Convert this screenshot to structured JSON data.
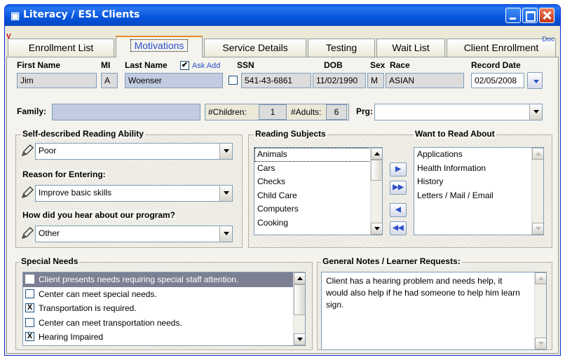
{
  "window": {
    "title": "Literacy / ESL Clients",
    "v_tag": "V",
    "doc_tag": "Doc"
  },
  "tabs": [
    {
      "label": "Enrollment List",
      "active": false
    },
    {
      "label": "Motivations",
      "active": true
    },
    {
      "label": "Service Details",
      "active": false
    },
    {
      "label": "Testing",
      "active": false
    },
    {
      "label": "Wait List",
      "active": false
    },
    {
      "label": "Client Enrollment",
      "active": false
    }
  ],
  "client": {
    "labels": {
      "first_name": "First Name",
      "mi": "MI",
      "last_name": "Last Name",
      "ask_add": "Ask Add",
      "ssn": "SSN",
      "dob": "DOB",
      "sex": "Sex",
      "race": "Race",
      "record_date": "Record Date",
      "family": "Family:",
      "children": "#Children:",
      "adults": "#Adults:",
      "prg": "Prg:"
    },
    "first_name": "Jim",
    "mi": "A",
    "last_name": "Woenser",
    "ask_add_checked": true,
    "ssn": "541-43-6861",
    "dob": "11/02/1990",
    "sex": "M",
    "race": "ASIAN",
    "record_date": "02/05/2008",
    "family": "",
    "children": "1",
    "adults": "6",
    "prg": ""
  },
  "reading": {
    "ability_label": "Self-described Reading Ability",
    "ability": "Poor",
    "reason_label": "Reason for Entering:",
    "reason": "Improve basic skills",
    "heard_label": "How did you hear about our program?",
    "heard": "Other"
  },
  "subjects": {
    "title": "Reading Subjects",
    "items": [
      "Animals",
      "Cars",
      "Checks",
      "Child Care",
      "Computers",
      "Cooking"
    ]
  },
  "want": {
    "title": "Want to Read About",
    "items": [
      "Applications",
      "Health Information",
      "History",
      "Letters / Mail / Email"
    ]
  },
  "move_buttons": {
    "add": "▶",
    "add_all": "▶▶",
    "remove": "◀",
    "remove_all": "◀◀"
  },
  "special_needs": {
    "title": "Special Needs",
    "items": [
      {
        "label": "Client presents needs requiring special staff attention.",
        "checked": false,
        "mark": ""
      },
      {
        "label": "Center can meet special needs.",
        "checked": false,
        "mark": ""
      },
      {
        "label": "Transportation is required.",
        "checked": true,
        "mark": "X"
      },
      {
        "label": "Center can meet transportation needs.",
        "checked": false,
        "mark": ""
      },
      {
        "label": "Hearing Impaired",
        "checked": true,
        "mark": "X"
      }
    ]
  },
  "notes": {
    "title": "General Notes / Learner Requests:",
    "text": "Client has a hearing problem and needs help, it would also help if he had someone to help him learn sign."
  },
  "icons": {
    "title_icon": "app-icon",
    "check": "✔",
    "pencil": "pencil-icon"
  }
}
